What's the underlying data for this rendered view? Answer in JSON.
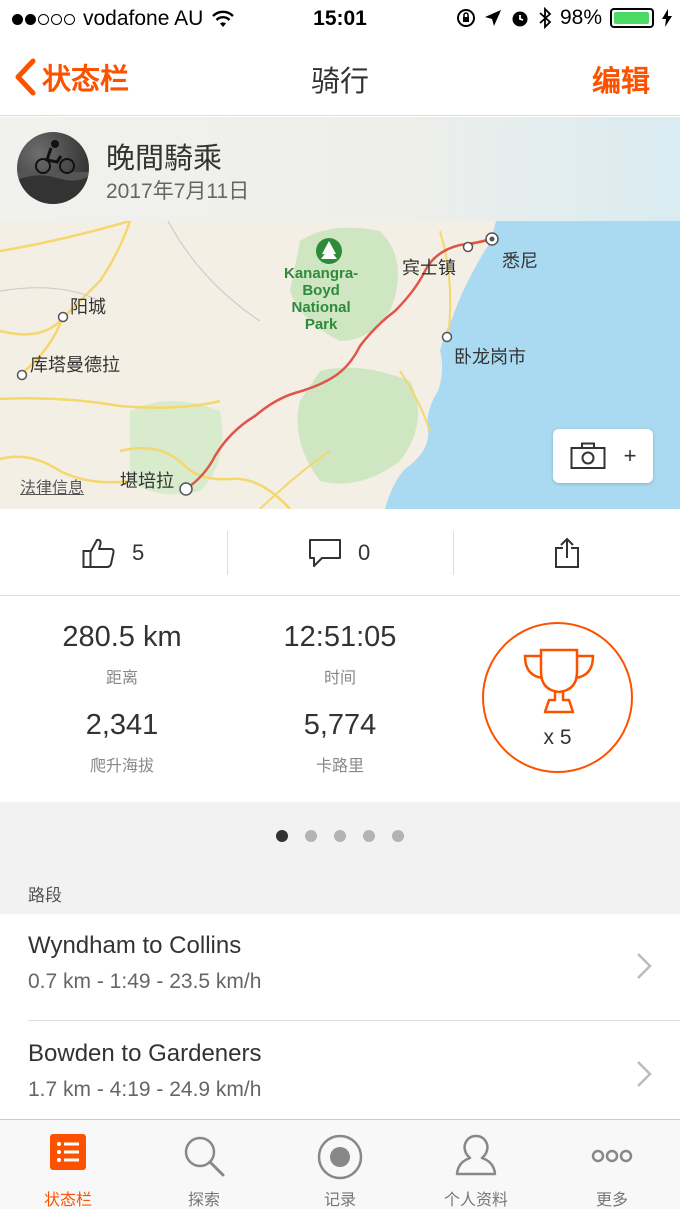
{
  "status_bar": {
    "carrier": "vodafone AU",
    "time": "15:01",
    "battery": "98%",
    "battery_level": 0.98
  },
  "nav": {
    "back_label": "状态栏",
    "title": "骑行",
    "edit_label": "编辑"
  },
  "activity": {
    "name": "晚間騎乘",
    "date": "2017年7月11日"
  },
  "map": {
    "labels": {
      "yangcheng": "阳城",
      "kutamandela": "库塔曼德拉",
      "binshizhen": "宾士镇",
      "sydney": "悉尼",
      "wollongong": "卧龙岗市",
      "canberra": "堪培拉"
    },
    "park": [
      "Kanangra-",
      "Boyd",
      "National",
      "Park"
    ],
    "legal": "法律信息",
    "add_photo_plus": "+"
  },
  "social": {
    "kudos": "5",
    "comments": "0"
  },
  "stats": {
    "distance": {
      "value": "280.5 km",
      "label": "距离"
    },
    "time": {
      "value": "12:51:05",
      "label": "时间"
    },
    "elevation": {
      "value": "2,341",
      "label": "爬升海拔"
    },
    "calories": {
      "value": "5,774",
      "label": "卡路里"
    },
    "achievements": "x 5"
  },
  "pager": {
    "count": 5,
    "active": 0
  },
  "segments_header": "路段",
  "segments": [
    {
      "name": "Wyndham to Collins",
      "detail": "0.7 km - 1:49 - 23.5 km/h"
    },
    {
      "name": "Bowden to Gardeners",
      "detail": "1.7 km - 4:19 - 24.9 km/h"
    }
  ],
  "tabs": [
    {
      "label": "状态栏",
      "icon": "feed-icon"
    },
    {
      "label": "探索",
      "icon": "search-icon"
    },
    {
      "label": "记录",
      "icon": "record-icon"
    },
    {
      "label": "个人资料",
      "icon": "profile-icon"
    },
    {
      "label": "更多",
      "icon": "more-icon"
    }
  ],
  "colors": {
    "accent": "#fc5200",
    "route": "#e0554a",
    "water": "#aadaf2"
  }
}
